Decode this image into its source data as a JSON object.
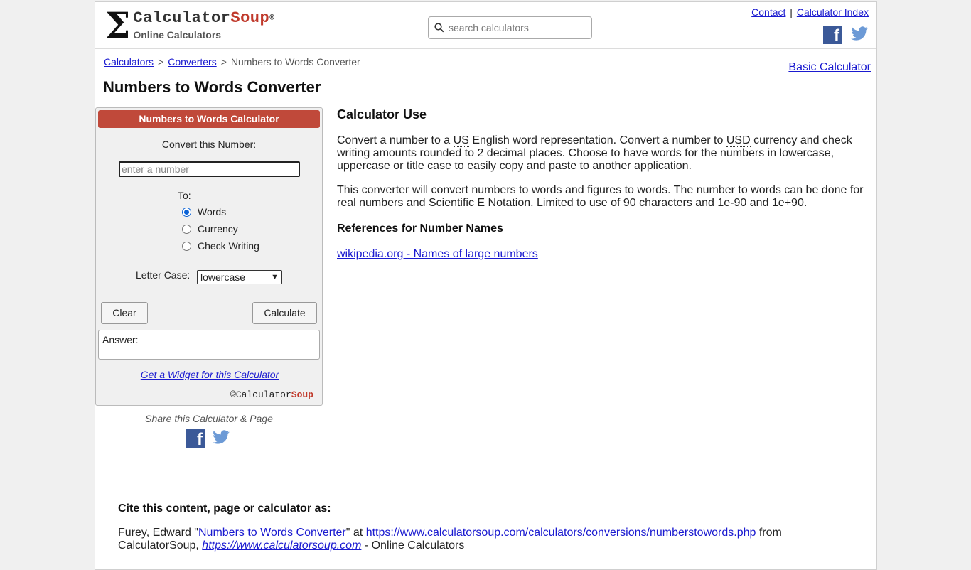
{
  "header": {
    "brand_main": "Calculator",
    "brand_accent": "Soup",
    "brand_reg": "®",
    "tagline": "Online Calculators",
    "search_placeholder": "search calculators",
    "contact": "Contact",
    "separator": "|",
    "calculator_index": "Calculator Index"
  },
  "breadcrumb": {
    "items": [
      "Calculators",
      "Converters"
    ],
    "current": "Numbers to Words Converter",
    "separator": ">"
  },
  "basic_calculator": "Basic Calculator",
  "page_title": "Numbers to Words Converter",
  "calculator": {
    "header": "Numbers to Words Calculator",
    "convert_label": "Convert this Number:",
    "input_placeholder": "enter a number",
    "to_label": "To:",
    "options": [
      "Words",
      "Currency",
      "Check Writing"
    ],
    "selected_option": "Words",
    "letter_case_label": "Letter Case:",
    "letter_case_value": "lowercase",
    "clear": "Clear",
    "calculate": "Calculate",
    "answer_label": "Answer:",
    "widget_link": "Get a Widget for this Calculator",
    "copyright_symbol": "©",
    "copyright_main": "Calculator",
    "copyright_accent": "Soup"
  },
  "share": {
    "text": "Share this Calculator & Page"
  },
  "content": {
    "heading": "Calculator Use",
    "p1_a": "Convert a number to a ",
    "p1_us": "US",
    "p1_b": " English word representation. Convert a number to ",
    "p1_usd": "USD",
    "p1_c": " currency and check writing amounts rounded to 2 decimal places.  Choose to have words for the numbers in lowercase, uppercase or title case to easily copy and paste to another application.",
    "p2": "This converter will convert numbers to words and figures to words. The number to words can be done for real numbers and Scientific E Notation. Limited to use of 90 characters and 1e-90 and 1e+90.",
    "references_heading": "References for Number Names",
    "reference_link": "wikipedia.org - Names of large numbers"
  },
  "cite": {
    "title": "Cite this content, page or calculator as:",
    "author": "Furey, Edward \"",
    "page_link": "Numbers to Words Converter",
    "at": "\" at ",
    "url": "https://www.calculatorsoup.com/calculators/conversions/numberstowords.php",
    "from": " from CalculatorSoup, ",
    "site_url": "https://www.calculatorsoup.com",
    "suffix": " - Online Calculators"
  },
  "colors": {
    "accent": "#c0493a",
    "link": "#1a1ad0",
    "facebook": "#3b5998",
    "twitter": "#6c9ad6"
  }
}
